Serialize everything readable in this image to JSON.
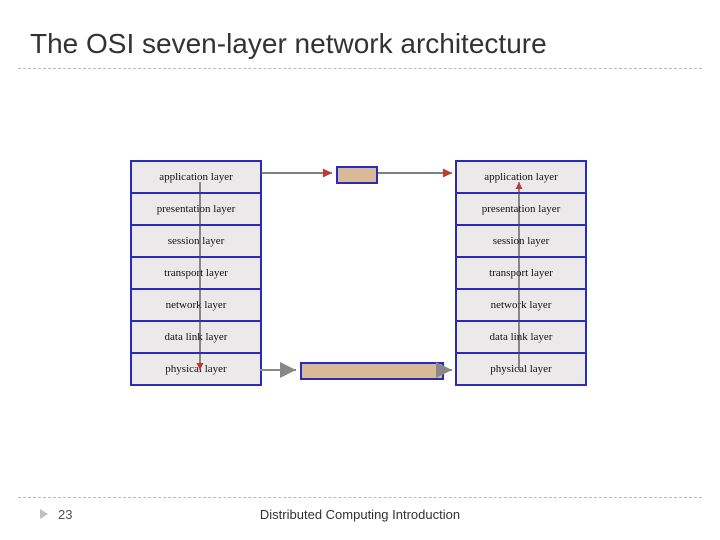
{
  "slide": {
    "title": "The OSI seven-layer network architecture",
    "number": "23",
    "footer": "Distributed Computing Introduction"
  },
  "layers": {
    "left": [
      "application layer",
      "presentation layer",
      "session layer",
      "transport layer",
      "network layer",
      "data link layer",
      "physical layer"
    ],
    "right": [
      "application layer",
      "presentation layer",
      "session layer",
      "transport layer",
      "network layer",
      "data link layer",
      "physical layer"
    ]
  },
  "colors": {
    "border": "#2b2bb8",
    "packet": "#D8BA99"
  }
}
